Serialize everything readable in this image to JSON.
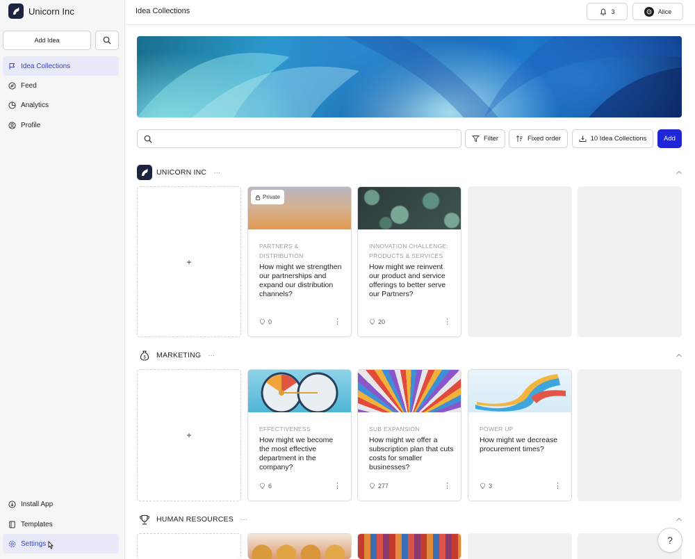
{
  "sidebar": {
    "brand_name": "Unicorn Inc",
    "add_idea_label": "Add Idea",
    "nav_items": [
      {
        "label": "Idea Collections",
        "icon": "flag-icon",
        "active": true
      },
      {
        "label": "Feed",
        "icon": "compass-icon"
      },
      {
        "label": "Analytics",
        "icon": "pie-chart-icon"
      },
      {
        "label": "Profile",
        "icon": "user-circle-icon"
      }
    ],
    "bottom_items": [
      {
        "label": "Install App",
        "icon": "download-circle-icon"
      },
      {
        "label": "Templates",
        "icon": "book-icon"
      },
      {
        "label": "Settings",
        "icon": "gear-icon"
      }
    ]
  },
  "header": {
    "title": "Idea Collections",
    "notification_count": "3",
    "user_name": "Alice"
  },
  "toolbar": {
    "search_placeholder": "",
    "filter_label": "Filter",
    "order_label": "Fixed order",
    "collections_label": "10 Idea Collections",
    "add_label": "Add"
  },
  "sections": [
    {
      "title": "UNICORN INC",
      "more": "···",
      "add_symbol": "+",
      "cards": [
        {
          "badge": "Private",
          "category": "PARTNERS & DISTRIBUTION",
          "question": "How might we strengthen our partnerships and expand our distribution channels?",
          "count": "0"
        },
        {
          "category": "INNOVATION CHALLENGE: PRODUCTS & SERVICES",
          "question": "How might we reinvent our product and service offerings to better serve our Partners?",
          "count": "20"
        }
      ]
    },
    {
      "title": "MARKETING",
      "more": "···",
      "add_symbol": "+",
      "cards": [
        {
          "category": "EFFECTIVENESS",
          "question": "How might we become the most effective department in the company?",
          "count": "6"
        },
        {
          "category": "SUB EXPANSION",
          "question": "How might we offer a subscription plan that cuts costs for smaller businesses?",
          "count": "277"
        },
        {
          "category": "POWER UP",
          "question": "How might we decrease procurement times?",
          "count": "3"
        }
      ]
    },
    {
      "title": "HUMAN RESOURCES",
      "more": "···"
    }
  ],
  "help_label": "?",
  "colors": {
    "accent": "#1f27d8",
    "active_nav_bg": "#e8eaf9",
    "active_nav_text": "#3342c8"
  }
}
